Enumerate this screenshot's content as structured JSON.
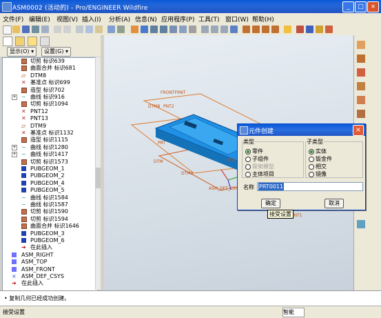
{
  "window": {
    "title": "ASM0002 (活动的) - Pro/ENGINEER Wildfire",
    "buttons": [
      "_",
      "□",
      "×"
    ]
  },
  "menu": [
    "文件(F)",
    "编辑(E)",
    "视图(V)",
    "插入(I)",
    "分析(A)",
    "信息(N)",
    "应用程序(P)",
    "工具(T)",
    "窗口(W)",
    "帮助(H)"
  ],
  "nav": {
    "show_dropdown": "显示(O) ▾",
    "settings_dropdown": "设置(G) ▾",
    "tree_rows": [
      {
        "label": "切剪 标识639",
        "icon": "fc",
        "level": 1
      },
      {
        "label": "曲面合并 标识681",
        "icon": "fc",
        "level": 1
      },
      {
        "label": "DTM8",
        "icon": "dt",
        "level": 1
      },
      {
        "label": "基准点 标识699",
        "icon": "pt",
        "level": 1
      },
      {
        "label": "造型 标识702",
        "icon": "fc",
        "level": 1
      },
      {
        "label": "曲线 标识916",
        "icon": "cv",
        "level": 1,
        "expandable": true
      },
      {
        "label": "切剪 标识1094",
        "icon": "fc",
        "level": 1
      },
      {
        "label": "PNT12",
        "icon": "pt",
        "level": 1
      },
      {
        "label": "PNT13",
        "icon": "pt",
        "level": 1
      },
      {
        "label": "DTM9",
        "icon": "dt",
        "level": 1
      },
      {
        "label": "基准点 标识1132",
        "icon": "pt",
        "level": 1
      },
      {
        "label": "造型 标识1115",
        "icon": "fc",
        "level": 1
      },
      {
        "label": "曲线 标识1280",
        "icon": "cv",
        "level": 1,
        "expandable": true
      },
      {
        "label": "曲线 标识1417",
        "icon": "cv",
        "level": 1,
        "expandable": true
      },
      {
        "label": "切剪 标识1573",
        "icon": "fc",
        "level": 1
      },
      {
        "label": "PUBGEOM_1",
        "icon": "pb",
        "level": 1
      },
      {
        "label": "PUBGEOM_2",
        "icon": "pb",
        "level": 1
      },
      {
        "label": "PUBGEOM_4",
        "icon": "pb",
        "level": 1
      },
      {
        "label": "PUBGEOM_5",
        "icon": "pb",
        "level": 1
      },
      {
        "label": "曲线 标识1584",
        "icon": "cv",
        "level": 1
      },
      {
        "label": "曲线 标识1587",
        "icon": "cv",
        "level": 1
      },
      {
        "label": "切剪 标识1590",
        "icon": "fc",
        "level": 1
      },
      {
        "label": "切剪 标识1594",
        "icon": "fc",
        "level": 1
      },
      {
        "label": "曲面合并 标识1646",
        "icon": "fc",
        "level": 1
      },
      {
        "label": "PUBGEOM_3",
        "icon": "pb",
        "level": 1
      },
      {
        "label": "PUBGEOM_6",
        "icon": "pb",
        "level": 1
      },
      {
        "label": "在此插入",
        "icon": "ins",
        "level": 1
      },
      {
        "label": "ASM_RIGHT",
        "icon": "dp",
        "level": 0
      },
      {
        "label": "ASM_TOP",
        "icon": "dp",
        "level": 0
      },
      {
        "label": "ASM_FRONT",
        "icon": "dp",
        "level": 0
      },
      {
        "label": "ASM_DEF_CSYS",
        "icon": "ax",
        "level": 0
      },
      {
        "label": "在此插入",
        "icon": "ins",
        "level": 0
      }
    ]
  },
  "graphics": {
    "labels": [
      "FRONTFRNT",
      "DTM8",
      "PNT2",
      "DTM",
      "PRT",
      "DTM9",
      "PNT1",
      "ASM_DEF_CSYS",
      "DTM"
    ]
  },
  "dialog": {
    "title": "元件创建",
    "type_group": "类型",
    "type_options": [
      {
        "label": "零件",
        "selected": true,
        "enabled": true
      },
      {
        "label": "子组件",
        "selected": false,
        "enabled": true
      },
      {
        "label": "骨架模型",
        "selected": false,
        "enabled": false
      },
      {
        "label": "主体项目",
        "selected": false,
        "enabled": true
      }
    ],
    "subtype_group": "子类型",
    "subtype_options": [
      {
        "label": "实体",
        "selected": true
      },
      {
        "label": "钣金件",
        "selected": false
      },
      {
        "label": "相交",
        "selected": false
      },
      {
        "label": "镜像",
        "selected": false
      }
    ],
    "name_label": "名称",
    "name_value": "PRT0011",
    "ok_label": "确定",
    "cancel_label": "取消"
  },
  "tooltip": "接受设置",
  "message": "• 复制几何已经成功创建。",
  "status": {
    "left": "接受设置",
    "right": "智能"
  },
  "colors": {
    "title_bar": "#1f54c4",
    "close_button": "#d9542b",
    "model_blue": "#1e90e6",
    "datum_orange": "#e07a2a"
  }
}
